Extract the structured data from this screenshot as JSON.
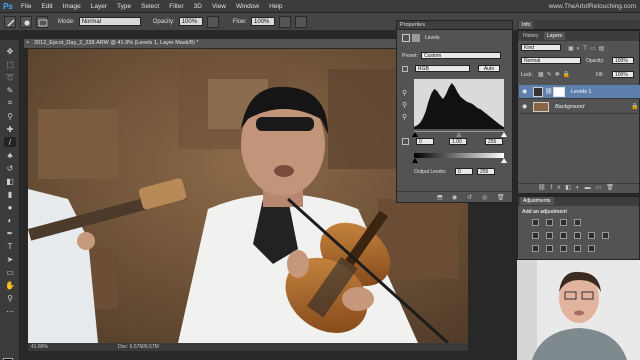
{
  "menubar": {
    "logo": "Ps",
    "items": [
      "File",
      "Edit",
      "Image",
      "Layer",
      "Type",
      "Select",
      "Filter",
      "3D",
      "View",
      "Window",
      "Help"
    ],
    "site": "www.TheArtofRetouching.com"
  },
  "options": {
    "mode_label": "Mode:",
    "mode_value": "Normal",
    "opacity_label": "Opacity:",
    "opacity_value": "100%",
    "flow_label": "Flow:",
    "flow_value": "100%"
  },
  "document": {
    "tab_title": "2012_Epcot_Day_2_238.ARW @ 41.9% (Levels 1, Layer Mask/8) *",
    "close": "×",
    "zoom": "41.89%",
    "doc_info": "Doc: 6.57M/6.57M"
  },
  "properties": {
    "panel_title": "Properties",
    "section_title": "Levels",
    "preset_label": "Preset:",
    "preset_value": "Custom",
    "channel_value": "RGB",
    "auto_label": "Auto",
    "input_black": "0",
    "input_gamma": "1.00",
    "input_white": "255",
    "output_label": "Output Levels:",
    "output_black": "0",
    "output_white": "255"
  },
  "panels_top": {
    "info_tab": "Info"
  },
  "layers": {
    "tabs": [
      "History",
      "Layers"
    ],
    "kind_label": "Kind",
    "blend_value": "Normal",
    "opacity_label": "Opacity:",
    "opacity_value": "100%",
    "lock_label": "Lock:",
    "fill_label": "Fill:",
    "fill_value": "100%",
    "items": [
      {
        "name": "Levels 1",
        "selected": true
      },
      {
        "name": "Background",
        "selected": false
      }
    ]
  },
  "adjustments": {
    "tab": "Adjustments",
    "heading": "Add an adjustment"
  },
  "colors": {
    "accent": "#4fa3ff",
    "selected_layer": "#5d7fae",
    "panel_bg": "#535353"
  },
  "histogram": [
    4,
    6,
    10,
    18,
    30,
    48,
    62,
    70,
    66,
    58,
    52,
    60,
    72,
    80,
    74,
    64,
    56,
    52,
    48,
    46,
    44,
    40,
    36,
    34,
    30,
    26,
    22,
    18,
    14,
    10,
    6,
    3
  ]
}
